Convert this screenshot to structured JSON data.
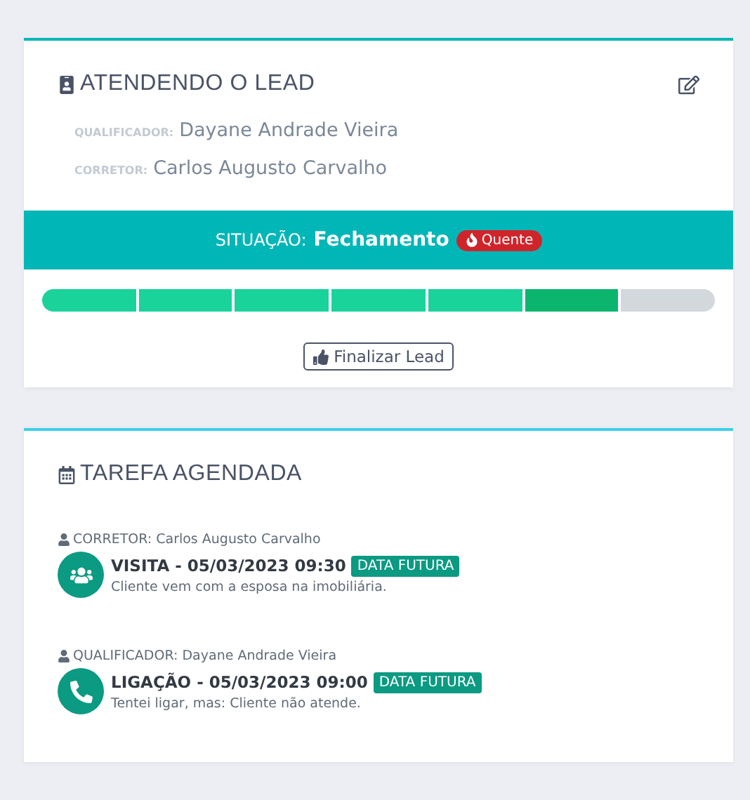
{
  "lead_card": {
    "title": "ATENDENDO O LEAD",
    "people": [
      {
        "role": "QUALIFICADOR:",
        "name": "Dayane Andrade Vieira"
      },
      {
        "role": "CORRETOR:",
        "name": "Carlos Augusto Carvalho"
      }
    ],
    "status": {
      "label": "SITUAÇÃO:",
      "value": "Fechamento",
      "badge": "Quente"
    },
    "stages": [
      {
        "done": true,
        "selected": false
      },
      {
        "done": true,
        "selected": false
      },
      {
        "done": true,
        "selected": false
      },
      {
        "done": true,
        "selected": false
      },
      {
        "done": true,
        "selected": false
      },
      {
        "done": true,
        "selected": true
      },
      {
        "done": false,
        "selected": false
      }
    ],
    "button": "Finalizar Lead"
  },
  "task_card": {
    "title": "TAREFA AGENDADA",
    "tasks": [
      {
        "kind": "visit",
        "owner": "CORRETOR: Carlos Augusto Carvalho",
        "title": "VISITA - 05/03/2023 09:30",
        "badge": "DATA FUTURA",
        "note": "Cliente vem com a esposa na imobiliária."
      },
      {
        "kind": "call",
        "owner": "QUALIFICADOR: Dayane Andrade Vieira",
        "title": "LIGAÇÃO - 05/03/2023 09:00",
        "badge": "DATA FUTURA",
        "note": "Tentei ligar, mas: Cliente não atende."
      }
    ]
  }
}
